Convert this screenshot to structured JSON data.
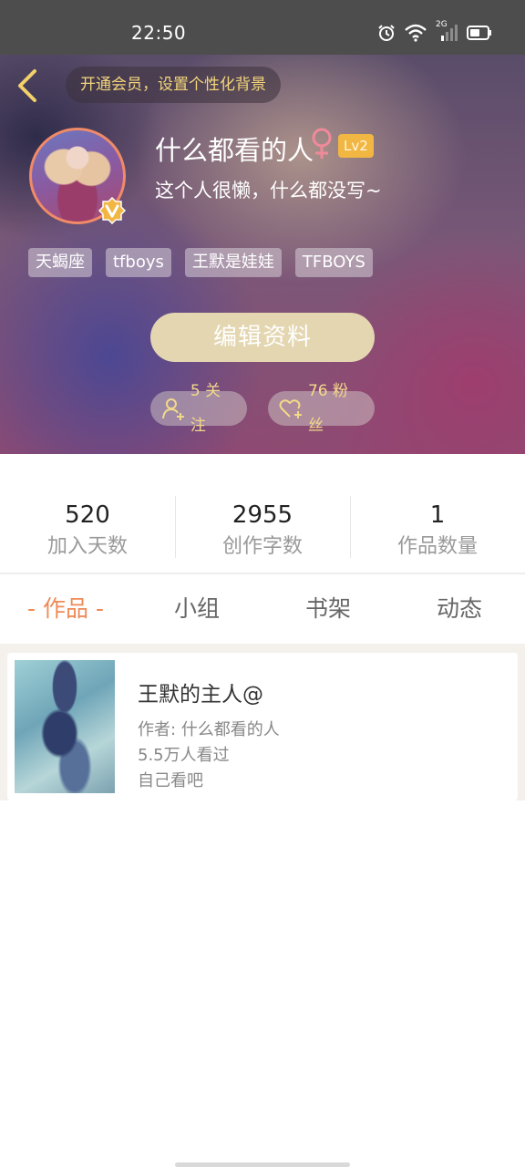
{
  "status_bar": {
    "time": "22:50",
    "network": "2G",
    "icons": [
      "alarm-icon",
      "wifi-icon",
      "signal-icon",
      "battery-icon"
    ]
  },
  "header": {
    "vip_prompt": "开通会员，设置个性化背景",
    "username": "什么都看的人",
    "gender_symbol": "♀",
    "level": "Lv2",
    "bio": "这个人很懒，什么都没写~",
    "tags": [
      "天蝎座",
      "tfboys",
      "王默是娃娃",
      "TFBOYS"
    ],
    "edit_label": "编辑资料",
    "follow_text": "5 关注",
    "fans_text": "76 粉丝"
  },
  "stats": [
    {
      "value": "520",
      "label": "加入天数"
    },
    {
      "value": "2955",
      "label": "创作字数"
    },
    {
      "value": "1",
      "label": "作品数量"
    }
  ],
  "tabs": [
    {
      "label": "- 作品 -",
      "active": true
    },
    {
      "label": "小组",
      "active": false
    },
    {
      "label": "书架",
      "active": false
    },
    {
      "label": "动态",
      "active": false
    }
  ],
  "works": [
    {
      "title": "王默的主人@",
      "author": "作者: 什么都看的人",
      "views": "5.5万人看过",
      "description": "自己看吧"
    }
  ],
  "colors": {
    "accent": "#ee8a56",
    "gold": "#f2d98a",
    "edit_button": "#e3d6b0",
    "level_badge": "#f2b642",
    "status_bar": "#4d4d4d"
  }
}
